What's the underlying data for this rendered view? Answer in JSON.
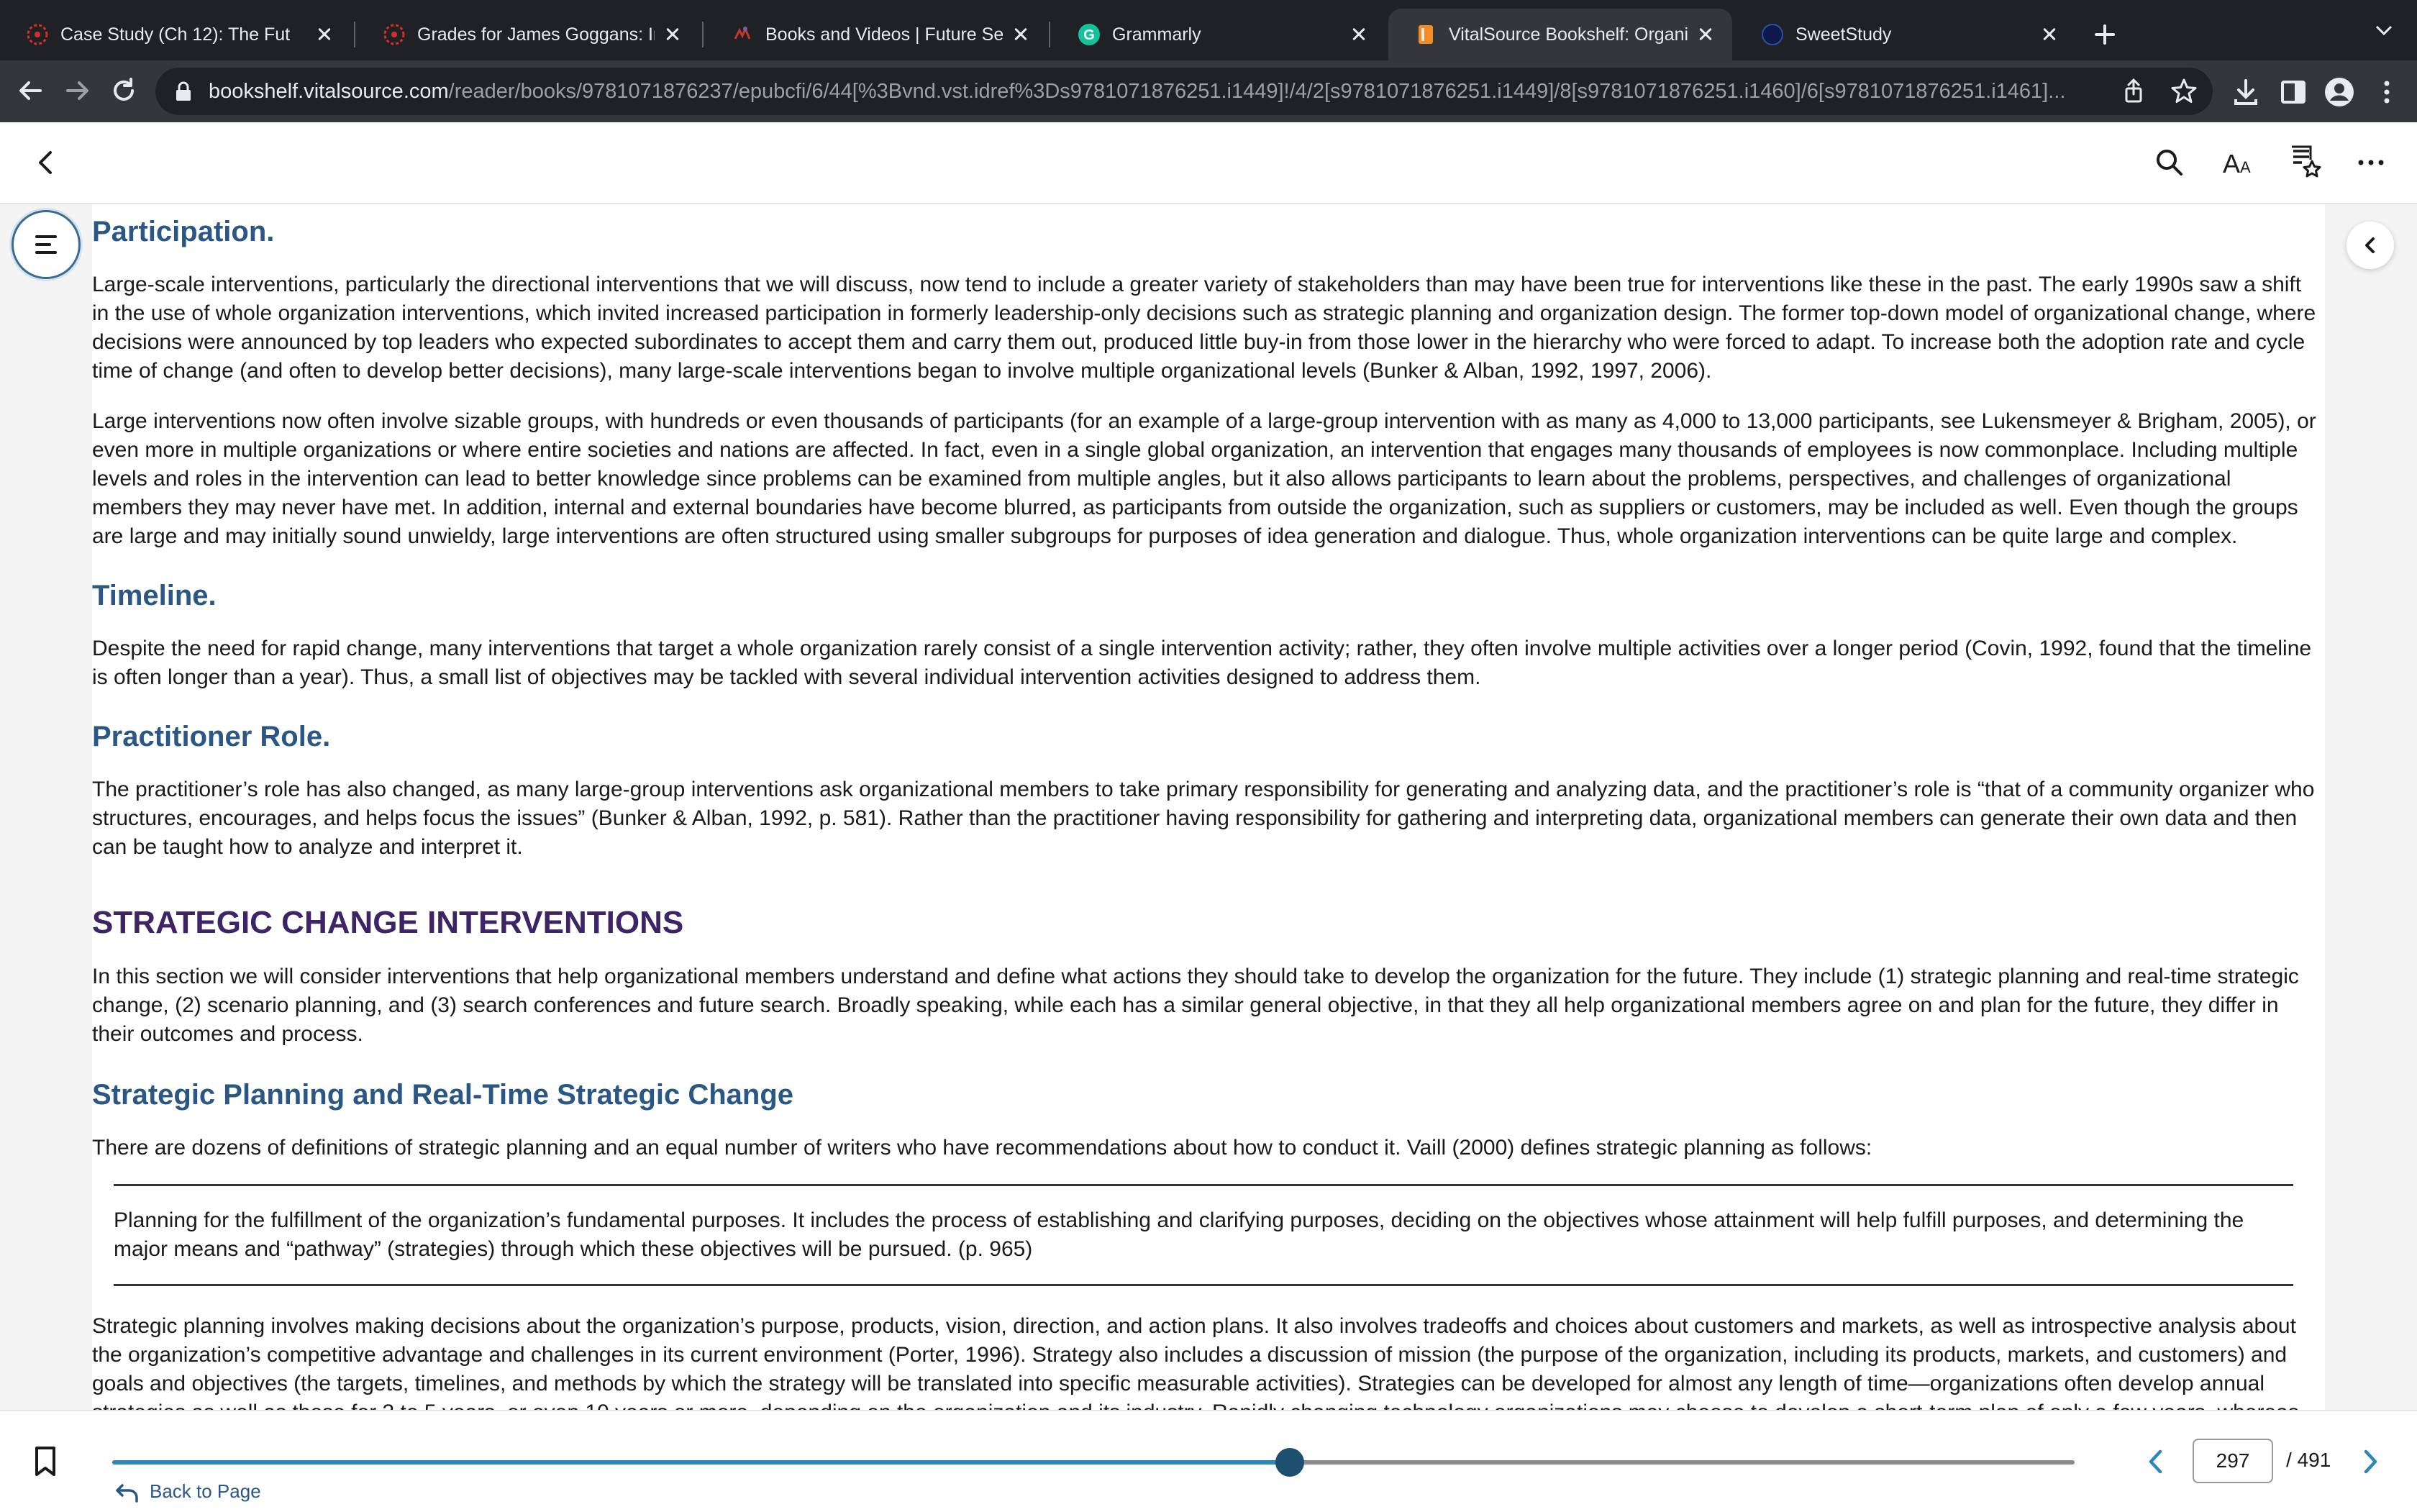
{
  "browser": {
    "tabs": [
      {
        "title": "Case Study (Ch 12): The Fut",
        "favicon": "asterisk-red-icon",
        "color": "#d93025"
      },
      {
        "title": "Grades for James Goggans: Int",
        "favicon": "asterisk-red-icon",
        "color": "#d93025"
      },
      {
        "title": "Books and Videos | Future Sear",
        "favicon": "future-search-icon",
        "color": "#7b5ea7"
      },
      {
        "title": "Grammarly",
        "favicon": "grammarly-icon",
        "color": "#15c39a"
      },
      {
        "title": "VitalSource Bookshelf: Organiz",
        "favicon": "vitalsource-icon",
        "color": "#f28c28"
      },
      {
        "title": "SweetStudy",
        "favicon": "sweetstudy-icon",
        "color": "#1a3a8a"
      }
    ],
    "active_tab_index": 4,
    "url_host": "bookshelf.vitalsource.com",
    "url_path": "/reader/books/9781071876237/epubcfi/6/44[%3Bvnd.vst.idref%3Ds9781071876251.i1449]!/4/2[s9781071876251.i1449]/8[s9781071876251.i1460]/6[s9781071876251.i1461]..."
  },
  "content": {
    "participation_heading": "Participation.",
    "participation_p1": "Large-scale interventions, particularly the directional interventions that we will discuss, now tend to include a greater variety of stakeholders than may have been true for interventions like these in the past. The early 1990s saw a shift in the use of whole organization interventions, which invited increased participation in formerly leadership-only decisions such as strategic planning and organization design. The former top-down model of organizational change, where decisions were announced by top leaders who expected subordinates to accept them and carry them out, produced little buy-in from those lower in the hierarchy who were forced to adapt. To increase both the adoption rate and cycle time of change (and often to develop better decisions), many large-scale interventions began to involve multiple organizational levels (Bunker & Alban, 1992, 1997, 2006).",
    "participation_p2": "Large interventions now often involve sizable groups, with hundreds or even thousands of participants (for an example of a large-group intervention with as many as 4,000 to 13,000 participants, see Lukensmeyer & Brigham, 2005), or even more in multiple organizations or where entire societies and nations are affected. In fact, even in a single global organization, an intervention that engages many thousands of employees is now commonplace. Including multiple levels and roles in the intervention can lead to better knowledge since problems can be examined from multiple angles, but it also allows participants to learn about the problems, perspectives, and challenges of organizational members they may never have met. In addition, internal and external boundaries have become blurred, as participants from outside the organization, such as suppliers or customers, may be included as well. Even though the groups are large and may initially sound unwieldy, large interventions are often structured using smaller subgroups for purposes of idea generation and dialogue. Thus, whole organization interventions can be quite large and complex.",
    "timeline_heading": "Timeline.",
    "timeline_p": "Despite the need for rapid change, many interventions that target a whole organization rarely consist of a single intervention activity; rather, they often involve multiple activities over a longer period (Covin, 1992, found that the timeline is often longer than a year). Thus, a small list of objectives may be tackled with several individual intervention activities designed to address them.",
    "role_heading": "Practitioner Role.",
    "role_p": "The practitioner’s role has also changed, as many large-group interventions ask organizational members to take primary responsibility for generating and analyzing data, and the practitioner’s role is “that of a community organizer who structures, encourages, and helps focus the issues” (Bunker & Alban, 1992, p. 581). Rather than the practitioner having responsibility for gathering and interpreting data, organizational members can generate their own data and then can be taught how to analyze and interpret it.",
    "section_heading": "STRATEGIC CHANGE INTERVENTIONS",
    "section_p": "In this section we will consider interventions that help organizational members understand and define what actions they should take to develop the organization for the future. They include (1) strategic planning and real-time strategic change, (2) scenario planning, and (3) search conferences and future search. Broadly speaking, while each has a similar general objective, in that they all help organizational members agree on and plan for the future, they differ in their outcomes and process.",
    "sp_heading": "Strategic Planning and Real-Time Strategic Change",
    "sp_p1": "There are dozens of definitions of strategic planning and an equal number of writers who have recommendations about how to conduct it. Vaill (2000) defines strategic planning as follows:",
    "quote": "Planning for the fulfillment of the organization’s fundamental purposes. It includes the process of establishing and clarifying purposes, deciding on the objectives whose attainment will help fulfill purposes, and determining the major means and “pathway” (strategies) through which these objectives will be pursued. (p. 965)",
    "sp_p2": "Strategic planning involves making decisions about the organization’s purpose, products, vision, direction, and action plans. It also involves tradeoffs and choices about customers and markets, as well as introspective analysis about the organization’s competitive advantage and challenges in its current environment (Porter, 1996). Strategy also includes a discussion of mission (the purpose of the organization, including its products, markets, and customers) and goals and objectives (the targets, timelines, and methods by which the strategy will be translated into specific measurable activities). Strategies can be developed for almost any length of time—organizations often develop annual strategies as well as those for 3 to 5 years, or even 10 years or more, depending on the organization and its industry. Rapidly changing technology organizations may choose to develop a short-term plan of only a few years, whereas"
  },
  "footer": {
    "back_label": "Back to Page",
    "current_page": "297",
    "total_pages": "/ 491",
    "progress_fraction": 0.6
  },
  "colors": {
    "heading_blue": "#2a5785",
    "section_purple": "#3d2467",
    "accent": "#2f86b8"
  }
}
